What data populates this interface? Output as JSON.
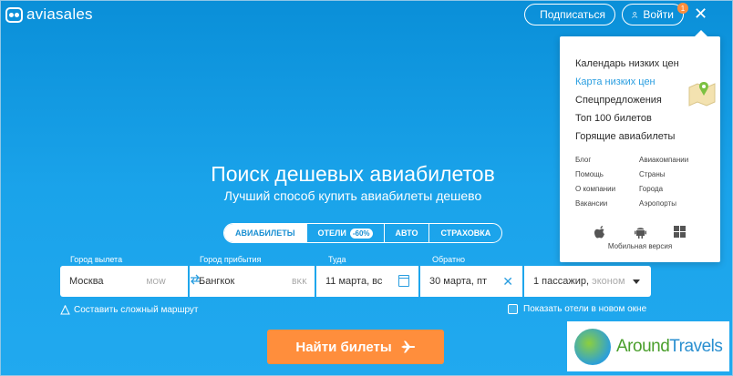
{
  "header": {
    "logo_text": "aviasales",
    "subscribe_label": "Подписаться",
    "login_label": "Войти",
    "notification_count": "1",
    "close_glyph": "✕"
  },
  "menu": {
    "items": [
      {
        "label": "Календарь низких цен",
        "active": false
      },
      {
        "label": "Карта низких цен",
        "active": true
      },
      {
        "label": "Спецпредложения",
        "active": false
      },
      {
        "label": "Топ 100 билетов",
        "active": false
      },
      {
        "label": "Горящие авиабилеты",
        "active": false
      }
    ],
    "links": [
      "Блог",
      "Авиакомпании",
      "Помощь",
      "Страны",
      "О компании",
      "Города",
      "Вакансии",
      "Аэропорты"
    ],
    "mobile_label": "Мобильная версия"
  },
  "hero": {
    "title": "Поиск дешевых авиабилетов",
    "subtitle": "Лучший способ купить авиабилеты дешево"
  },
  "tabs": [
    {
      "label": "АВИАБИЛЕТЫ",
      "active": true
    },
    {
      "label": "ОТЕЛИ",
      "badge": "-60%",
      "active": false
    },
    {
      "label": "АВТО",
      "active": false
    },
    {
      "label": "СТРАХОВКА",
      "active": false
    }
  ],
  "search": {
    "from_label": "Город вылета",
    "from_value": "Москва",
    "from_iata": "MOW",
    "to_label": "Город прибытия",
    "to_value": "Бангкок",
    "to_iata": "BKK",
    "depart_label": "Туда",
    "depart_value": "11 марта, вс",
    "return_label": "Обратно",
    "return_value": "30 марта, пт",
    "passengers_value": "1 пассажир,",
    "class_value": "эконом",
    "complex_route": "Составить сложный маршрут",
    "show_hotels": "Показать отели в новом окне",
    "submit_label": "Найти билеты"
  },
  "watermark": {
    "text_a": "Around",
    "text_b": "Travels"
  },
  "colors": {
    "background": "#1aa3ea",
    "accent": "#2a9ee0",
    "cta": "#ff8e3c"
  }
}
